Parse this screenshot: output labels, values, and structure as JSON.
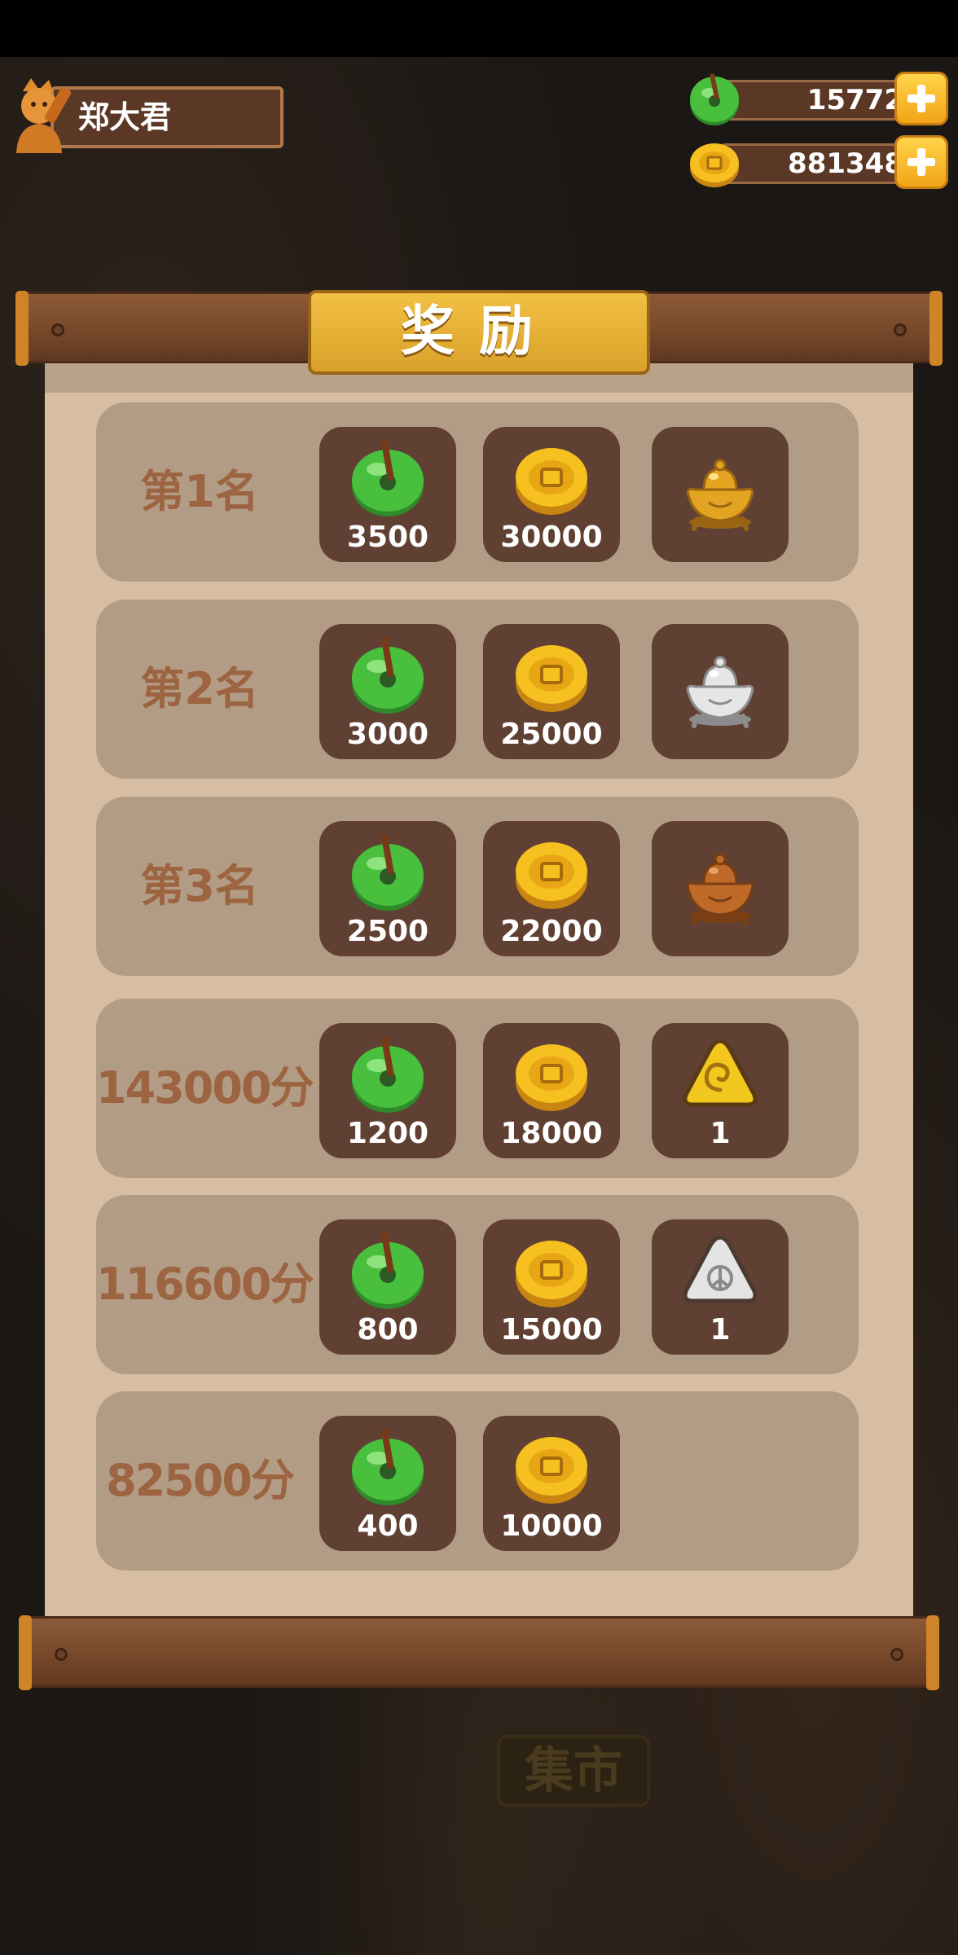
{
  "player": {
    "name": "郑大君"
  },
  "currency": {
    "jade": {
      "value": "15772",
      "icon": "jade-disc-icon"
    },
    "coins": {
      "value": "881348",
      "icon": "gold-coin-icon"
    }
  },
  "background": {
    "market_sign": "集市"
  },
  "dialog": {
    "title": "奖励"
  },
  "rewards": [
    {
      "rank": "第1名",
      "jade": "3500",
      "coins": "30000",
      "item": "gold-incense-burner-icon",
      "item_amount": ""
    },
    {
      "rank": "第2名",
      "jade": "3000",
      "coins": "25000",
      "item": "silver-incense-burner-icon",
      "item_amount": ""
    },
    {
      "rank": "第3名",
      "jade": "2500",
      "coins": "22000",
      "item": "bronze-incense-burner-icon",
      "item_amount": ""
    },
    {
      "rank": "143000分",
      "jade": "1200",
      "coins": "18000",
      "item": "gold-rune-token-icon",
      "item_amount": "1"
    },
    {
      "rank": "116600分",
      "jade": "800",
      "coins": "15000",
      "item": "silver-rune-token-icon",
      "item_amount": "1"
    },
    {
      "rank": "82500分",
      "jade": "400",
      "coins": "10000",
      "item": "",
      "item_amount": ""
    }
  ],
  "colors": {
    "wood": "#7a4a2c",
    "paper": "#d7bda2",
    "row": "#b39c85",
    "slot": "#5f4033",
    "rank_text": "#9c6440",
    "title_gold": "#e8b235"
  }
}
